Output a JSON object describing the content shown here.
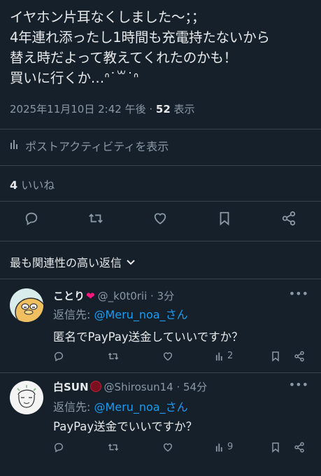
{
  "tweet": {
    "text": "イヤホン片耳なくしました〜；；\n4年連れ添ったし1時間も充電持たないから\n替え時だよって教えてくれたのかも！\n買いに行くか…ᐢ˙꒳˙ᐢ",
    "datetime": "2025年11月10日 2:42 午後",
    "sep": " · ",
    "views": "52",
    "views_label": " 表示",
    "activity_label": "ポストアクティビティを表示",
    "likes_count": "4",
    "likes_label": "いいね"
  },
  "replies_section": {
    "title": "最も関連性の高い返信"
  },
  "replies": [
    {
      "name": "ことり",
      "handle": "@_k0t0rii · 3分",
      "reply_to_label": "返信先: ",
      "reply_to_user": "@Meru_noa_さん",
      "text": "匿名でPayPay送金していいですか？",
      "views": "2"
    },
    {
      "name": "白SUN",
      "handle": "@Shirosun14 · 54分",
      "reply_to_label": "返信先: ",
      "reply_to_user": "@Meru_noa_さん",
      "text": "PayPay送金でいいですか？",
      "views": "9"
    }
  ],
  "colors": {
    "background": "#15202b",
    "accent": "#1d9bf0",
    "muted": "#8b98a5",
    "divider": "#38444d",
    "heart": "#f91880"
  },
  "icons": [
    "chart-icon",
    "reply-icon",
    "retweet-icon",
    "like-icon",
    "bookmark-icon",
    "share-icon",
    "chevron-down-icon",
    "more-icon",
    "heart-emoji-icon"
  ]
}
